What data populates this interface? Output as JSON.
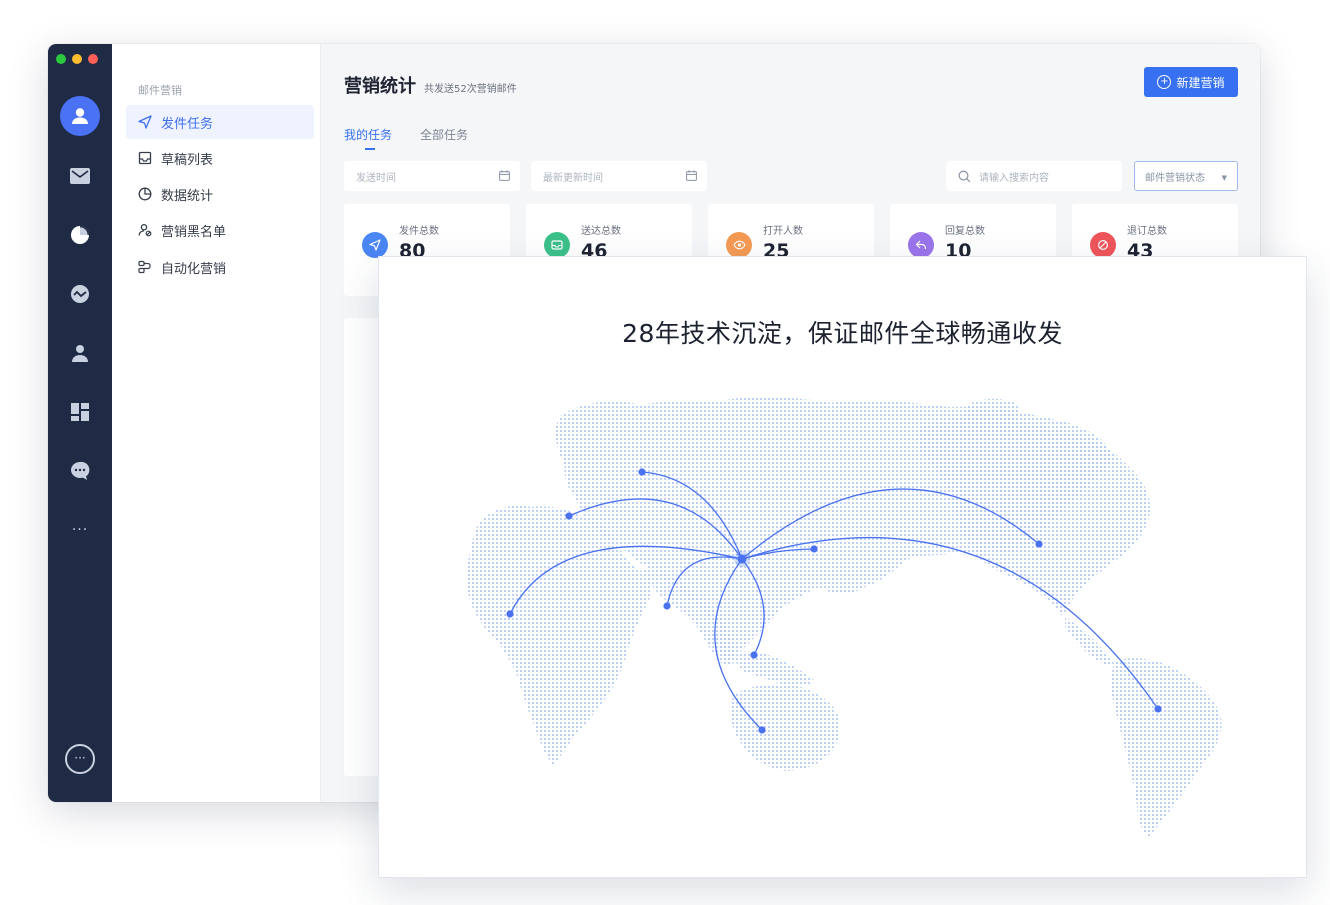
{
  "sidebar": {
    "section_title": "邮件营销",
    "items": [
      {
        "label": "发件任务",
        "icon": "send-icon",
        "active": true
      },
      {
        "label": "草稿列表",
        "icon": "draft-icon",
        "active": false
      },
      {
        "label": "数据统计",
        "icon": "pie-chart-icon",
        "active": false
      },
      {
        "label": "营销黑名单",
        "icon": "blacklist-user-icon",
        "active": false
      },
      {
        "label": "自动化营销",
        "icon": "automation-icon",
        "active": false
      }
    ]
  },
  "dock": {
    "icons": [
      "avatar-icon",
      "mail-icon",
      "pie-chart-icon",
      "trend-icon",
      "contacts-icon",
      "dashboard-icon",
      "chat-icon",
      "more-dots-icon",
      "more-circle-icon"
    ],
    "more_label": "···"
  },
  "header": {
    "title": "营销统计",
    "subtitle": "共发送52次营销邮件",
    "new_button": "新建营销"
  },
  "tabs": [
    {
      "label": "我的任务",
      "active": true
    },
    {
      "label": "全部任务",
      "active": false
    }
  ],
  "filters": {
    "send_time_placeholder": "发送时间",
    "update_time_placeholder": "最新更新时间",
    "search_placeholder": "请输入搜索内容",
    "status_select": "邮件营销状态"
  },
  "stats": [
    {
      "label": "发件总数",
      "value": "80",
      "color": "#4b86f5",
      "icon": "send-icon"
    },
    {
      "label": "送达总数",
      "value": "46",
      "color": "#3cc18a",
      "icon": "inbox-icon"
    },
    {
      "label": "打开人数",
      "value": "25",
      "color": "#f59a54",
      "icon": "eye-icon"
    },
    {
      "label": "回复总数",
      "value": "10",
      "color": "#9b74ec",
      "icon": "reply-icon"
    },
    {
      "label": "退订总数",
      "value": "43",
      "color": "#f0555a",
      "icon": "unsubscribe-icon"
    }
  ],
  "overlay": {
    "headline": "28年技术沉淀，保证邮件全球畅通收发"
  },
  "colors": {
    "accent": "#3770f0",
    "dock_bg": "#1f2a44",
    "map_dots": "#a9c4f2",
    "route": "#4a72f0"
  }
}
